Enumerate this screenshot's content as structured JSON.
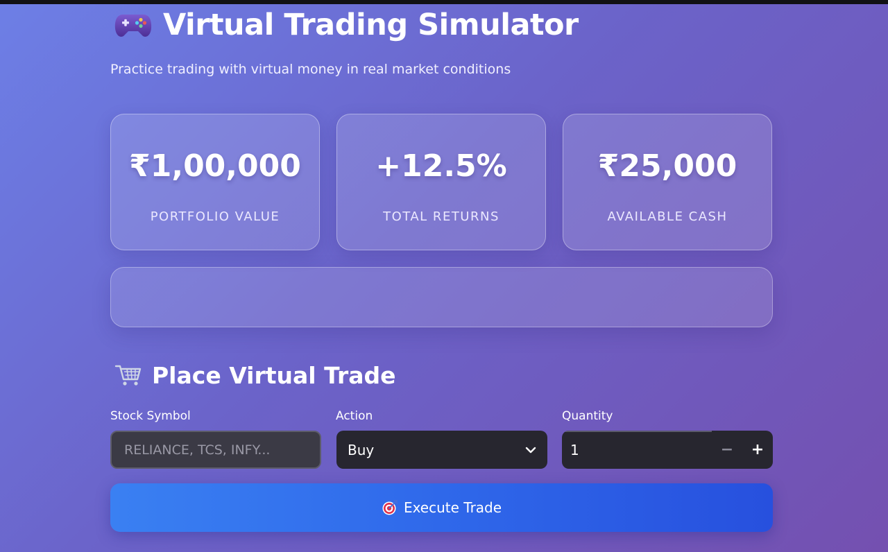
{
  "header": {
    "icon": "gamepad-icon",
    "title": "Virtual Trading Simulator",
    "subtitle": "Practice trading with virtual money in real market conditions"
  },
  "metrics": [
    {
      "value": "₹1,00,000",
      "label": "PORTFOLIO VALUE"
    },
    {
      "value": "+12.5%",
      "label": "TOTAL RETURNS"
    },
    {
      "value": "₹25,000",
      "label": "AVAILABLE CASH"
    }
  ],
  "trade": {
    "section_icon": "shopping-cart-icon",
    "section_title": "Place Virtual Trade",
    "symbol": {
      "label": "Stock Symbol",
      "value": "",
      "placeholder": "RELIANCE, TCS, INFY..."
    },
    "action": {
      "label": "Action",
      "value": "Buy"
    },
    "quantity": {
      "label": "Quantity",
      "value": "1",
      "decrement": "−",
      "increment": "+"
    },
    "execute_icon": "target-icon",
    "execute_label": "Execute Trade"
  },
  "colors": {
    "background_start": "#6d7fe6",
    "background_end": "#7450b0",
    "button_start": "#3a80f2",
    "button_end": "#2750de",
    "input_dark": "#27262f"
  }
}
